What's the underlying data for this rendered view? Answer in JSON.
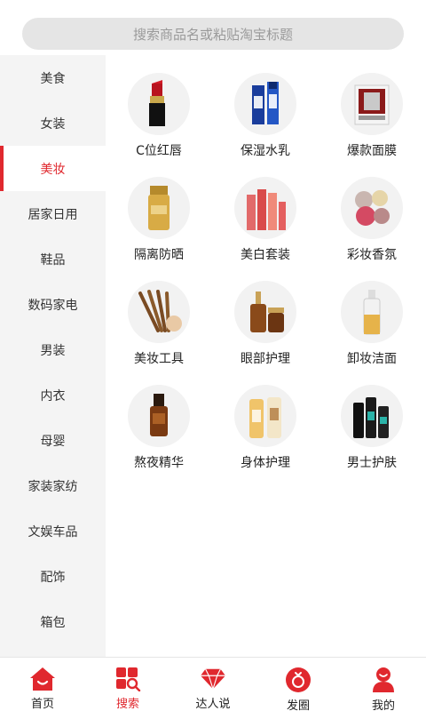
{
  "search": {
    "placeholder": "搜索商品名或粘贴淘宝标题"
  },
  "sidebar": {
    "items": [
      {
        "label": "美食"
      },
      {
        "label": "女装"
      },
      {
        "label": "美妆"
      },
      {
        "label": "居家日用"
      },
      {
        "label": "鞋品"
      },
      {
        "label": "数码家电"
      },
      {
        "label": "男装"
      },
      {
        "label": "内衣"
      },
      {
        "label": "母婴"
      },
      {
        "label": "家装家纺"
      },
      {
        "label": "文娱车品"
      },
      {
        "label": "配饰"
      },
      {
        "label": "箱包"
      }
    ],
    "selected": "美妆"
  },
  "categories": [
    {
      "label": "C位红唇",
      "icon": "lipstick-icon"
    },
    {
      "label": "保湿水乳",
      "icon": "lotion-bottles-icon"
    },
    {
      "label": "爆款面膜",
      "icon": "face-mask-icon"
    },
    {
      "label": "隔离防晒",
      "icon": "sunscreen-icon"
    },
    {
      "label": "美白套装",
      "icon": "whitening-set-icon"
    },
    {
      "label": "彩妆香氛",
      "icon": "makeup-palette-icon"
    },
    {
      "label": "美妆工具",
      "icon": "makeup-brushes-icon"
    },
    {
      "label": "眼部护理",
      "icon": "eye-serum-icon"
    },
    {
      "label": "卸妆洁面",
      "icon": "cleanser-bottle-icon"
    },
    {
      "label": "熬夜精华",
      "icon": "night-serum-icon"
    },
    {
      "label": "身体护理",
      "icon": "body-care-icon"
    },
    {
      "label": "男士护肤",
      "icon": "mens-skincare-icon"
    }
  ],
  "tabbar": {
    "items": [
      {
        "label": "首页",
        "icon": "home-icon"
      },
      {
        "label": "搜索",
        "icon": "search-grid-icon"
      },
      {
        "label": "达人说",
        "icon": "diamond-icon"
      },
      {
        "label": "发圈",
        "icon": "share-circle-icon"
      },
      {
        "label": "我的",
        "icon": "user-icon"
      }
    ],
    "active": "搜索"
  },
  "colors": {
    "accent": "#e0282e",
    "sidebar_bg": "#f4f4f4",
    "search_bg": "#e5e5e5"
  }
}
